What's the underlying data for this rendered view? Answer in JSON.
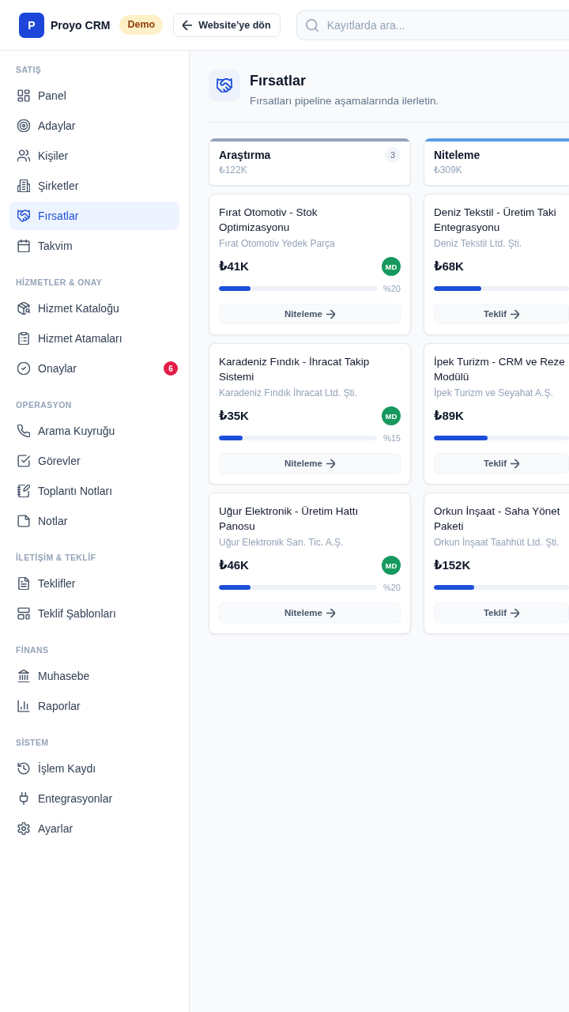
{
  "topbar": {
    "logo_letter": "P",
    "app_name": "Proyo CRM",
    "badge": "Demo",
    "back_button": "Website’ye dön",
    "search": {
      "placeholder": "Kayıtlarda ara..."
    }
  },
  "sidebar": {
    "sections": [
      {
        "heading": "SATIŞ",
        "items": [
          {
            "label": "Panel",
            "selected": false
          },
          {
            "label": "Adaylar",
            "selected": false
          },
          {
            "label": "Kişiler",
            "selected": false
          },
          {
            "label": "Şirketler",
            "selected": false
          },
          {
            "label": "Fırsatlar",
            "selected": true
          },
          {
            "label": "Takvim",
            "selected": false
          }
        ]
      },
      {
        "heading": "HİZMETLER & ONAY",
        "items": [
          {
            "label": "Hizmet Kataloğu",
            "selected": false
          },
          {
            "label": "Hizmet Atamaları",
            "selected": false
          },
          {
            "label": "Onaylar",
            "selected": false,
            "badge": "6"
          }
        ]
      },
      {
        "heading": "OPERASYON",
        "items": [
          {
            "label": "Arama Kuyruğu",
            "selected": false
          },
          {
            "label": "Görevler",
            "selected": false
          },
          {
            "label": "Toplantı Notları",
            "selected": false
          },
          {
            "label": "Notlar",
            "selected": false
          }
        ]
      },
      {
        "heading": "İLETİŞİM & TEKLİF",
        "items": [
          {
            "label": "Teklifler",
            "selected": false
          },
          {
            "label": "Teklif Şablonları",
            "selected": false
          }
        ]
      },
      {
        "heading": "FİNANS",
        "items": [
          {
            "label": "Muhasebe",
            "selected": false
          },
          {
            "label": "Raporlar",
            "selected": false
          }
        ]
      },
      {
        "heading": "SİSTEM",
        "items": [
          {
            "label": "İşlem Kaydı",
            "selected": false
          },
          {
            "label": "Entegrasyonlar",
            "selected": false
          },
          {
            "label": "Ayarlar",
            "selected": false
          }
        ]
      }
    ]
  },
  "page_header": {
    "title": "Fırsatlar",
    "subtitle": "Fırsatları pipeline aşamalarında ilerletin."
  },
  "stages": [
    {
      "name": "Araştırma",
      "total": "₺122K",
      "count": "3",
      "color": "#94a3b8",
      "deals": [
        {
          "title": "Fırat Otomotiv - Stok Optimizasyonu",
          "company": "Fırat Otomotiv Yedek Parça",
          "amount": "₺41K",
          "owner": "MD",
          "level": 0.2,
          "percent": "%20",
          "action": "Niteleme"
        },
        {
          "title": "Karadeniz Fındık - İhracat Takip Sistemi",
          "company": "Karadeniz Fındık İhracat Ltd. Şti.",
          "amount": "₺35K",
          "owner": "MD",
          "level": 0.15,
          "percent": "%15",
          "action": "Niteleme"
        },
        {
          "title": "Uğur Elektronik - Üretim Hattı Panosu",
          "company": "Uğur Elektronik San. Tic. A.Ş.",
          "amount": "₺46K",
          "owner": "MD",
          "level": 0.2,
          "percent": "%20",
          "action": "Niteleme"
        }
      ]
    },
    {
      "name": "Niteleme",
      "total": "₺309K",
      "color": "#5b9be6",
      "deals": [
        {
          "title": "Deniz Tekstil - Üretim Taki Entegrasyonu",
          "company": "Deniz Tekstil Ltd. Şti.",
          "amount": "₺68K",
          "level": 0.35,
          "action": "Teklif"
        },
        {
          "title": "İpek Turizm - CRM ve Reze Modülü",
          "company": "İpek Turizm ve Seyahat A.Ş.",
          "amount": "₺89K",
          "level": 0.4,
          "action": "Teklif"
        },
        {
          "title": "Orkun İnşaat - Saha Yönet Paketi",
          "company": "Orkun İnşaat Taahhüt Ltd. Şti.",
          "amount": "₺152K",
          "level": 0.3,
          "action": "Teklif"
        }
      ]
    }
  ]
}
